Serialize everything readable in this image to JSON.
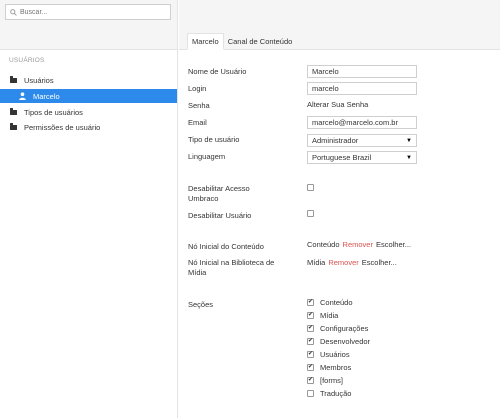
{
  "search": {
    "placeholder": "Buscar..."
  },
  "sidebar": {
    "section_title": "USUÁRIOS",
    "items": [
      {
        "label": "Usuários",
        "icon": "folder-icon"
      },
      {
        "label": "Marcelo",
        "icon": "user-icon",
        "active": true
      },
      {
        "label": "Tipos de usuários",
        "icon": "folder-icon"
      },
      {
        "label": "Permissões de usuário",
        "icon": "folder-icon"
      }
    ]
  },
  "tabs": [
    {
      "label": "Marcelo",
      "active": true
    },
    {
      "label": "Canal de Conteúdo",
      "active": false
    }
  ],
  "form": {
    "username_label": "Nome de Usuário",
    "username_value": "Marcelo",
    "login_label": "Login",
    "login_value": "marcelo",
    "password_label": "Senha",
    "password_link": "Alterar Sua Senha",
    "email_label": "Email",
    "email_value": "marcelo@marcelo.com.br",
    "usertype_label": "Tipo de usuário",
    "usertype_value": "Administrador",
    "language_label": "Linguagem",
    "language_value": "Portuguese Brazil",
    "disable_umbraco_label": "Desabilitar Acesso Umbraco",
    "disable_user_label": "Desabilitar Usuário",
    "content_start_label": "Nó Inicial do Conteúdo",
    "content_start_current": "Conteúdo",
    "media_start_label": "Nó Inicial na Biblioteca de Mídia",
    "media_start_current": "Mídia",
    "remove_label": "Remover",
    "choose_label": "Escolher...",
    "sections_label": "Seções",
    "sections": [
      {
        "label": "Conteúdo",
        "checked": true
      },
      {
        "label": "Mídia",
        "checked": true
      },
      {
        "label": "Configurações",
        "checked": true
      },
      {
        "label": "Desenvolvedor",
        "checked": true
      },
      {
        "label": "Usuários",
        "checked": true
      },
      {
        "label": "Membros",
        "checked": true
      },
      {
        "label": "[forms]",
        "checked": true
      },
      {
        "label": "Tradução",
        "checked": false
      }
    ]
  }
}
